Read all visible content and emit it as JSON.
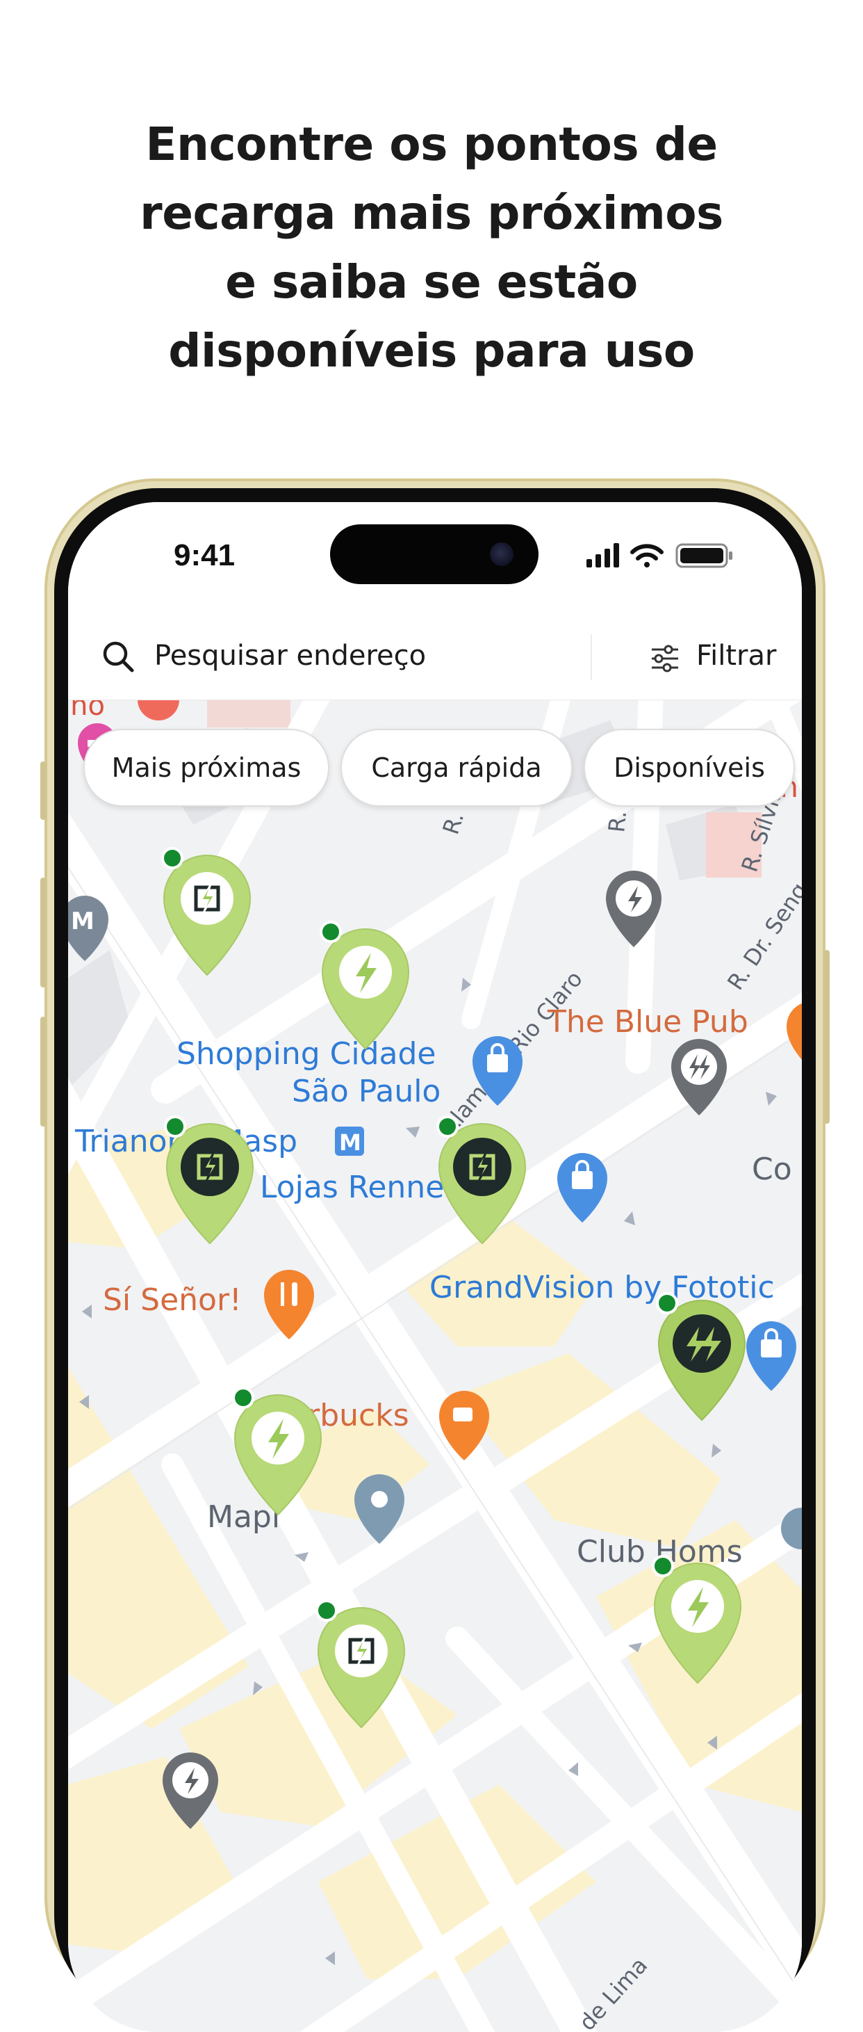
{
  "headline": {
    "lines": [
      "Encontre os pontos de",
      "recarga mais próximos",
      "e saiba se estão",
      "disponíveis para uso"
    ]
  },
  "status_bar": {
    "time": "9:41"
  },
  "search": {
    "placeholder": "Pesquisar endereço",
    "filter_label": "Filtrar"
  },
  "chips": [
    "Mais próximas",
    "Carga rápida",
    "Disponíveis"
  ],
  "map": {
    "streets": [
      "Alameda Rio Claro",
      "R.",
      "R. F",
      "R. Sílvia",
      "R. Dr. Seng",
      "de Lima"
    ],
    "places": {
      "shopping": "Shopping Cidade São Paulo",
      "shopping_line1": "Shopping Cidade",
      "shopping_line2": "São Paulo",
      "trianon": "Trianon - Masp",
      "metro_symbol": "M",
      "renner": "Lojas Renner",
      "blue_pub": "The Blue Pub",
      "sisenor": "Sí Señor!",
      "grandvision": "GrandVision by Fototic",
      "starbucks": "Starbucks",
      "maple": "Mapl",
      "club_homs": "Club Homs",
      "cut_co": "Co",
      "cut_in": "In",
      "cut_top": "ino"
    }
  },
  "colors": {
    "pin_light_green": "#b8d977",
    "pin_dark_green": "#1f2a2a",
    "available_dot": "#138a2e",
    "pin_gray": "#6b6e73",
    "road_white": "#ffffff",
    "map_bg": "#f1f2f4",
    "block_yellow": "#fbf1cc"
  }
}
